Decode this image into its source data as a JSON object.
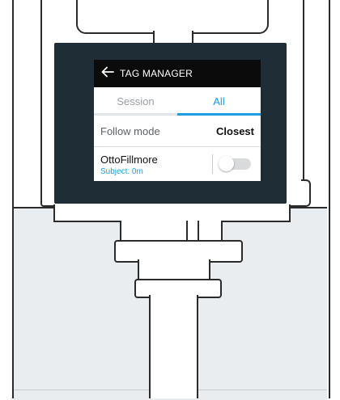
{
  "screen": {
    "title": "TAG MANAGER",
    "back_icon": "arrow-left-icon",
    "tabs": [
      {
        "label": "Session",
        "active": false
      },
      {
        "label": "All",
        "active": true
      }
    ],
    "follow_mode": {
      "label": "Follow mode",
      "value": "Closest"
    },
    "tag_item": {
      "name": "OttoFillmore",
      "subtitle": "Subject: 0m",
      "toggle_on": false
    }
  },
  "colors": {
    "accent": "#1a9ee0",
    "title_bar": "#0b0b0b",
    "bezel": "#1f2e36",
    "wall": "#e9edf0"
  }
}
